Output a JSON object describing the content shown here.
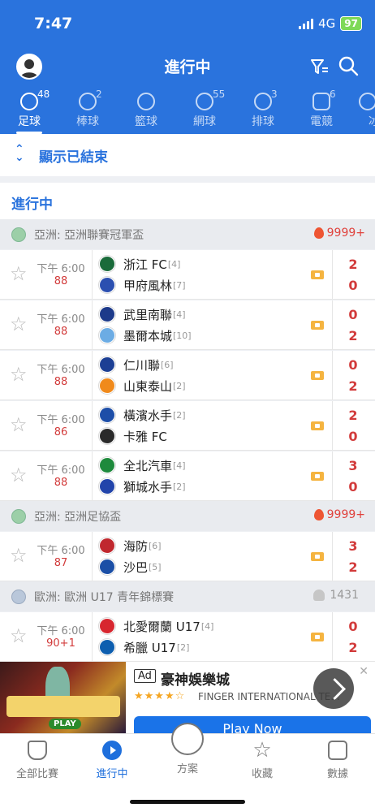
{
  "status": {
    "time": "7:47",
    "network": "4G",
    "battery": "97"
  },
  "header": {
    "title": "進行中"
  },
  "tabs": [
    {
      "label": "足球",
      "count": "48",
      "icon": "soccer-ball-icon"
    },
    {
      "label": "棒球",
      "count": "2",
      "icon": "baseball-icon"
    },
    {
      "label": "籃球",
      "count": "",
      "icon": "basketball-icon"
    },
    {
      "label": "網球",
      "count": "55",
      "icon": "tennis-icon"
    },
    {
      "label": "排球",
      "count": "3",
      "icon": "volleyball-icon"
    },
    {
      "label": "電競",
      "count": "6",
      "icon": "gamepad-icon"
    },
    {
      "label": "冰",
      "count": "",
      "icon": "hockey-icon"
    }
  ],
  "show_ended": {
    "label": "顯示已結束"
  },
  "section": {
    "label": "進行中"
  },
  "leagues": [
    {
      "name": "亞洲: 亞洲聯賽冠軍盃",
      "heat": "9999+",
      "matches": [
        {
          "time": "下午 6:00",
          "minute": "88",
          "home": "浙江 FC",
          "home_rank": "[4]",
          "away": "甲府風林",
          "away_rank": "[7]",
          "home_score": "2",
          "away_score": "0",
          "home_color": "#1a6b3a",
          "away_color": "#2b4fb0"
        },
        {
          "time": "下午 6:00",
          "minute": "88",
          "home": "武里南聯",
          "home_rank": "[4]",
          "away": "墨爾本城",
          "away_rank": "[10]",
          "home_score": "0",
          "away_score": "2",
          "home_color": "#1d3a8a",
          "away_color": "#6cace4"
        },
        {
          "time": "下午 6:00",
          "minute": "88",
          "home": "仁川聯",
          "home_rank": "[6]",
          "away": "山東泰山",
          "away_rank": "[2]",
          "home_score": "0",
          "away_score": "2",
          "home_color": "#1c3f94",
          "away_color": "#f08a1c"
        },
        {
          "time": "下午 6:00",
          "minute": "86",
          "home": "橫濱水手",
          "home_rank": "[2]",
          "away": "卡雅 FC",
          "away_rank": "",
          "home_score": "2",
          "away_score": "0",
          "home_color": "#1d4ea8",
          "away_color": "#2a2a2a"
        },
        {
          "time": "下午 6:00",
          "minute": "88",
          "home": "全北汽車",
          "home_rank": "[4]",
          "away": "獅城水手",
          "away_rank": "[2]",
          "home_score": "3",
          "away_score": "0",
          "home_color": "#1e8a3c",
          "away_color": "#2244aa"
        }
      ]
    },
    {
      "name": "亞洲: 亞洲足協盃",
      "heat": "9999+",
      "matches": [
        {
          "time": "下午 6:00",
          "minute": "87",
          "home": "海防",
          "home_rank": "[6]",
          "away": "沙巴",
          "away_rank": "[5]",
          "home_score": "3",
          "away_score": "2",
          "home_color": "#c0282e",
          "away_color": "#1b4fa6"
        }
      ]
    },
    {
      "name": "歐洲: 歐洲 U17 青年錦標賽",
      "viewers": "1431",
      "matches": [
        {
          "time": "下午 6:00",
          "minute": "90+1",
          "home": "北愛爾蘭 U17",
          "home_rank": "[4]",
          "away": "希臘 U17",
          "away_rank": "[2]",
          "home_score": "0",
          "away_score": "2",
          "home_color": "#d7262f",
          "away_color": "#0d5eaf"
        }
      ]
    }
  ],
  "ad": {
    "badge": "Ad",
    "title": "豪神娛樂城",
    "stars": "★★★★☆",
    "developer": "FINGER INTERNATIONAL TE...",
    "cta": "Play Now",
    "play": "PLAY"
  },
  "bottom_nav": [
    {
      "label": "全部比賽",
      "icon": "trophy-icon"
    },
    {
      "label": "進行中",
      "icon": "play-circle-icon"
    },
    {
      "label": "方案",
      "icon": "document-icon"
    },
    {
      "label": "收藏",
      "icon": "star-icon"
    },
    {
      "label": "數據",
      "icon": "chart-icon"
    }
  ],
  "colors": {
    "primary": "#2a73dd",
    "score": "#d23b3b",
    "heat": "#e0413c"
  }
}
